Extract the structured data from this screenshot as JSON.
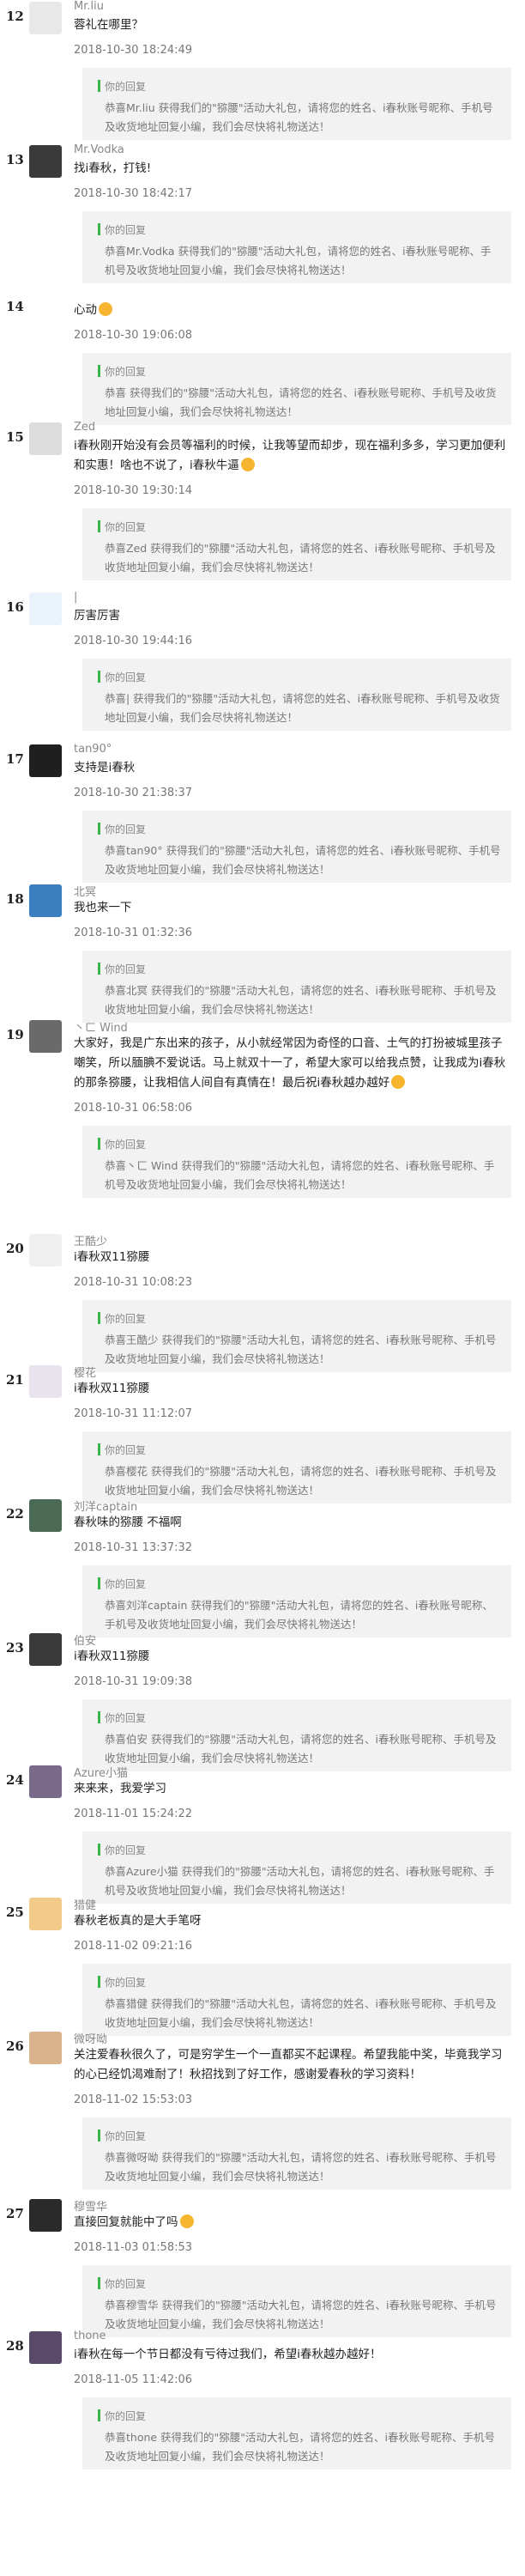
{
  "reply_label": "你的回复",
  "comments": [
    {
      "num": "12",
      "name": "Mr.liu",
      "content": "蓉礼在哪里？",
      "time": "2018-10-30 18:24:49",
      "avatar_color": "#e8e8e8",
      "reply": "恭喜Mr.liu 获得我们的\"猕腰\"活动大礼包，请将您的姓名、i春秋账号昵称、手机号及收货地址回复小编，我们会尽快将礼物送达！"
    },
    {
      "num": "13",
      "name": "Mr.Vodka",
      "content": "找i春秋，打钱!",
      "time": "2018-10-30 18:42:17",
      "avatar_color": "#3a3a3a",
      "reply": "恭喜Mr.Vodka 获得我们的\"猕腰\"活动大礼包，请将您的姓名、i春秋账号昵称、手机号及收货地址回复小编，我们会尽快将礼物送达！"
    },
    {
      "num": "14",
      "name": "",
      "content": "心动",
      "emoji": true,
      "time": "2018-10-30 19:06:08",
      "avatar_color": "",
      "reply": "恭喜 获得我们的\"猕腰\"活动大礼包，请将您的姓名、i春秋账号昵称、手机号及收货地址回复小编，我们会尽快将礼物送达！"
    },
    {
      "num": "15",
      "name": "Zed",
      "content": "i春秋刚开始没有会员等福利的时候，让我等望而却步，现在福利多多，学习更加便利和实惠！啥也不说了，i春秋牛逼",
      "emoji": true,
      "time": "2018-10-30 19:30:14",
      "avatar_color": "#dcdcdc",
      "reply": "恭喜Zed 获得我们的\"猕腰\"活动大礼包，请将您的姓名、i春秋账号昵称、手机号及收货地址回复小编，我们会尽快将礼物送达！"
    },
    {
      "num": "16",
      "name": "|",
      "content": "厉害厉害",
      "time": "2018-10-30 19:44:16",
      "avatar_color": "#eaf2fb",
      "reply": "恭喜| 获得我们的\"猕腰\"活动大礼包，请将您的姓名、i春秋账号昵称、手机号及收货地址回复小编，我们会尽快将礼物送达！"
    },
    {
      "num": "17",
      "name": "tan90°",
      "content": "支持是i春秋",
      "time": "2018-10-30 21:38:37",
      "avatar_color": "#1f1f1f",
      "reply": "恭喜tan90° 获得我们的\"猕腰\"活动大礼包，请将您的姓名、i春秋账号昵称、手机号及收货地址回复小编，我们会尽快将礼物送达！"
    },
    {
      "num": "18",
      "name": "北冥",
      "content": "我也来一下",
      "time": "2018-10-31 01:32:36",
      "avatar_color": "#3c7fc0",
      "reply": "恭喜北冥 获得我们的\"猕腰\"活动大礼包，请将您的姓名、i春秋账号昵称、手机号及收货地址回复小编，我们会尽快将礼物送达！"
    },
    {
      "num": "19",
      "name": "丶ㄈ Wind",
      "content": "大家好，我是广东出来的孩子，从小就经常因为奇怪的口音、土气的打扮被城里孩子嘲笑，所以腼腆不爱说话。马上就双十一了，希望大家可以给我点赞，让我成为i春秋的那条猕腰，让我相信人间自有真情在！最后祝i春秋越办越好",
      "emoji": true,
      "time": "2018-10-31 06:58:06",
      "avatar_color": "#6a6a6a",
      "reply": "恭喜丶ㄈ Wind 获得我们的\"猕腰\"活动大礼包，请将您的姓名、i春秋账号昵称、手机号及收货地址回复小编，我们会尽快将礼物送达！"
    },
    {
      "num": "20",
      "name": "王酷少",
      "content": "i春秋双11猕腰",
      "time": "2018-10-31 10:08:23",
      "avatar_color": "#f0f0f0",
      "reply": "恭喜王酷少 获得我们的\"猕腰\"活动大礼包，请将您的姓名、i春秋账号昵称、手机号及收货地址回复小编，我们会尽快将礼物送达！"
    },
    {
      "num": "21",
      "name": "樱花",
      "content": "i春秋双11猕腰",
      "time": "2018-10-31 11:12:07",
      "avatar_color": "#e9e3ee",
      "reply": "恭喜樱花 获得我们的\"猕腰\"活动大礼包，请将您的姓名、i春秋账号昵称、手机号及收货地址回复小编，我们会尽快将礼物送达！"
    },
    {
      "num": "22",
      "name": "刘洋captain",
      "content": "春秋味的猕腰 不福啊",
      "time": "2018-10-31 13:37:32",
      "avatar_color": "#4a6a55",
      "reply": "恭喜刘洋captain 获得我们的\"猕腰\"活动大礼包，请将您的姓名、i春秋账号昵称、手机号及收货地址回复小编，我们会尽快将礼物送达！"
    },
    {
      "num": "23",
      "name": "伯安",
      "content": "i春秋双11猕腰",
      "time": "2018-10-31 19:09:38",
      "avatar_color": "#3a3a3a",
      "reply": "恭喜伯安 获得我们的\"猕腰\"活动大礼包，请将您的姓名、i春秋账号昵称、手机号及收货地址回复小编，我们会尽快将礼物送达！"
    },
    {
      "num": "24",
      "name": "Azure小猫",
      "content": "来来来，我爱学习",
      "time": "2018-11-01 15:24:22",
      "avatar_color": "#7a6a8a",
      "reply": "恭喜Azure小猫 获得我们的\"猕腰\"活动大礼包，请将您的姓名、i春秋账号昵称、手机号及收货地址回复小编，我们会尽快将礼物送达！"
    },
    {
      "num": "25",
      "name": "猎健",
      "content": "春秋老板真的是大手笔呀",
      "time": "2018-11-02 09:21:16",
      "avatar_color": "#f3c98a",
      "reply": "恭喜猎健 获得我们的\"猕腰\"活动大礼包，请将您的姓名、i春秋账号昵称、手机号及收货地址回复小编，我们会尽快将礼物送达！"
    },
    {
      "num": "26",
      "name": "微呀呦",
      "content": "关注爱春秋很久了，可是穷学生一个一直都买不起课程。希望我能中奖，毕竟我学习的心已经饥渴难耐了！秋招找到了好工作，感谢爱春秋的学习资料！",
      "time": "2018-11-02 15:53:03",
      "avatar_color": "#d9b38c",
      "reply": "恭喜微呀呦 获得我们的\"猕腰\"活动大礼包，请将您的姓名、i春秋账号昵称、手机号及收货地址回复小编，我们会尽快将礼物送达！"
    },
    {
      "num": "27",
      "name": "穆雪华",
      "content": "直接回复就能中了吗",
      "emoji": true,
      "time": "2018-11-03 01:58:53",
      "avatar_color": "#2a2a2a",
      "reply": "恭喜穆雪华 获得我们的\"猕腰\"活动大礼包，请将您的姓名、i春秋账号昵称、手机号及收货地址回复小编，我们会尽快将礼物送达！"
    },
    {
      "num": "28",
      "name": "thone",
      "content": "i春秋在每一个节日都没有亏待过我们，希望i春秋越办越好！",
      "time": "2018-11-05 11:42:06",
      "avatar_color": "#5a4a6a",
      "reply": "恭喜thone 获得我们的\"猕腰\"活动大礼包，请将您的姓名、i春秋账号昵称、手机号及收货地址回复小编，我们会尽快将礼物送达！"
    }
  ]
}
